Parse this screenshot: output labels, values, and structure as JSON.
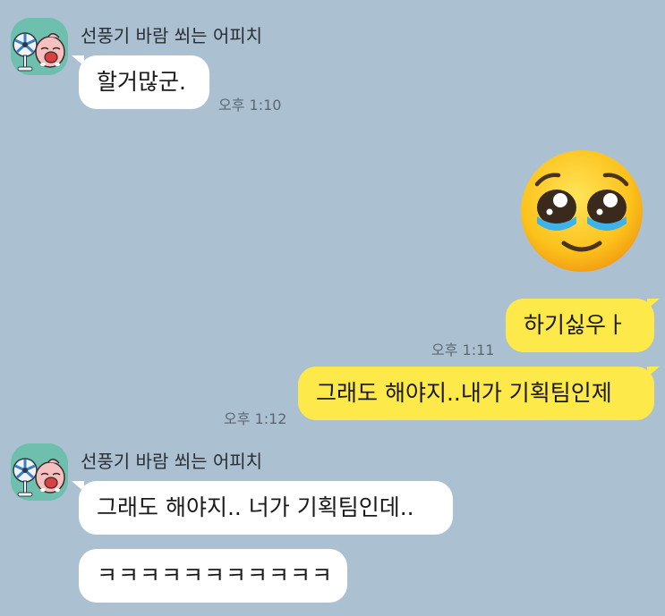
{
  "colors": {
    "background": "#abc1d1",
    "incoming_bubble": "#ffffff",
    "outgoing_bubble": "#fde94a",
    "avatar_bg": "#6fbfae"
  },
  "messages": [
    {
      "type": "incoming",
      "sender": "선풍기 바람 쐬는 어피치",
      "avatar_icon": "apeach-fan-avatar-icon",
      "text": "할거많군.",
      "time": "오후 1:10"
    },
    {
      "type": "outgoing-emoji",
      "emoji_icon": "pleading-face-emoji-icon"
    },
    {
      "type": "outgoing",
      "text": "하기싫우ㅏ",
      "time": "오후 1:11"
    },
    {
      "type": "outgoing",
      "text": "그래도 해야지..내가 기획팀인제",
      "time": "오후 1:12"
    },
    {
      "type": "incoming",
      "sender": "선풍기 바람 쐬는 어피치",
      "avatar_icon": "apeach-fan-avatar-icon",
      "text": "그래도 해야지.. 너가 기획팀인데..",
      "time": ""
    },
    {
      "type": "incoming-continuation",
      "text": "ㅋㅋㅋㅋㅋㅋㅋㅋㅋㅋㅋ",
      "time": ""
    }
  ]
}
